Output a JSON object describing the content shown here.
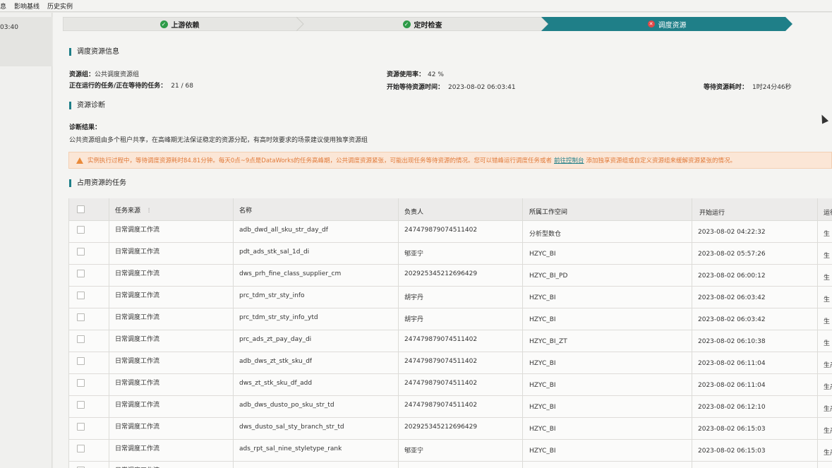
{
  "topbar": {
    "tabs": [
      "息",
      "影响基线",
      "历史实例"
    ]
  },
  "left": {
    "time": "03:40"
  },
  "steps": [
    {
      "label": "上游依赖",
      "status": "ok"
    },
    {
      "label": "定时检查",
      "status": "ok"
    },
    {
      "label": "调度资源",
      "status": "error"
    }
  ],
  "colors": {
    "accent": "#1f7f88",
    "ok": "#2e9b48",
    "error": "#e04848",
    "warning": "#e07a3a"
  },
  "resource_info": {
    "title": "调度资源信息",
    "group_label": "资源组：",
    "group_value": "公共调度资源组",
    "running_label": "正在运行的任务/正在等待的任务：",
    "running_value": "21 / 68",
    "usage_label": "资源使用率：",
    "usage_value": "42 %",
    "wait_start_label": "开始等待资源时间：",
    "wait_start_value": "2023-08-02 06:03:41",
    "wait_cost_label": "等待资源耗时：",
    "wait_cost_value": "1时24分46秒"
  },
  "diagnosis": {
    "title": "资源诊断",
    "result_label": "诊断结果：",
    "result_text": "公共资源组由多个租户共享，在高峰期无法保证稳定的资源分配，有高时效要求的场景建议使用独享资源组"
  },
  "warning": {
    "text_before": "实例执行过程中，等待调度资源耗时84.81分钟。每天0点~9点是DataWorks的任务高峰期，公共调度资源紧张，可能出现任务等待资源的情况。您可以错峰运行调度任务或者",
    "link": "前往控制台",
    "text_after": "添加独享资源组或自定义资源组来缓解资源紧张的情况。"
  },
  "tasks": {
    "title": "占用资源的任务",
    "columns": [
      "任务来源",
      "名称",
      "负责人",
      "所属工作空间",
      "开始运行",
      "运行"
    ],
    "rows": [
      {
        "source": "日常调度工作流",
        "name": "adb_dwd_all_sku_str_day_df",
        "owner": "247479879074511402",
        "workspace": "分析型数仓",
        "start": "2023-08-02 04:22:32",
        "env": "生"
      },
      {
        "source": "日常调度工作流",
        "name": "pdt_ads_stk_sal_1d_di",
        "owner": "郇亚宁",
        "workspace": "HZYC_BI",
        "start": "2023-08-02 05:57:26",
        "env": "生"
      },
      {
        "source": "日常调度工作流",
        "name": "dws_prh_fine_class_supplier_cm",
        "owner": "202925345212696429",
        "workspace": "HZYC_BI_PD",
        "start": "2023-08-02 06:00:12",
        "env": "生"
      },
      {
        "source": "日常调度工作流",
        "name": "prc_tdm_str_sty_info",
        "owner": "胡宇丹",
        "workspace": "HZYC_BI",
        "start": "2023-08-02 06:03:42",
        "env": "生"
      },
      {
        "source": "日常调度工作流",
        "name": "prc_tdm_str_sty_info_ytd",
        "owner": "胡宇丹",
        "workspace": "HZYC_BI",
        "start": "2023-08-02 06:03:42",
        "env": "生"
      },
      {
        "source": "日常调度工作流",
        "name": "prc_ads_zt_pay_day_di",
        "owner": "247479879074511402",
        "workspace": "HZYC_BI_ZT",
        "start": "2023-08-02 06:10:38",
        "env": "生"
      },
      {
        "source": "日常调度工作流",
        "name": "adb_dws_zt_stk_sku_df",
        "owner": "247479879074511402",
        "workspace": "HZYC_BI",
        "start": "2023-08-02 06:11:04",
        "env": "生产"
      },
      {
        "source": "日常调度工作流",
        "name": "dws_zt_stk_sku_df_add",
        "owner": "247479879074511402",
        "workspace": "HZYC_BI",
        "start": "2023-08-02 06:11:04",
        "env": "生产"
      },
      {
        "source": "日常调度工作流",
        "name": "adb_dws_dusto_po_sku_str_td",
        "owner": "247479879074511402",
        "workspace": "HZYC_BI",
        "start": "2023-08-02 06:12:10",
        "env": "生产"
      },
      {
        "source": "日常调度工作流",
        "name": "dws_dusto_sal_sty_branch_str_td",
        "owner": "202925345212696429",
        "workspace": "HZYC_BI",
        "start": "2023-08-02 06:15:03",
        "env": "生产"
      },
      {
        "source": "日常调度工作流",
        "name": "ads_rpt_sal_nine_styletype_rank",
        "owner": "郇亚宁",
        "workspace": "HZYC_BI",
        "start": "2023-08-02 06:15:03",
        "env": "生产"
      },
      {
        "source": "日常调度工作流",
        "name": "",
        "owner": "",
        "workspace": "",
        "start": "",
        "env": ""
      }
    ]
  }
}
